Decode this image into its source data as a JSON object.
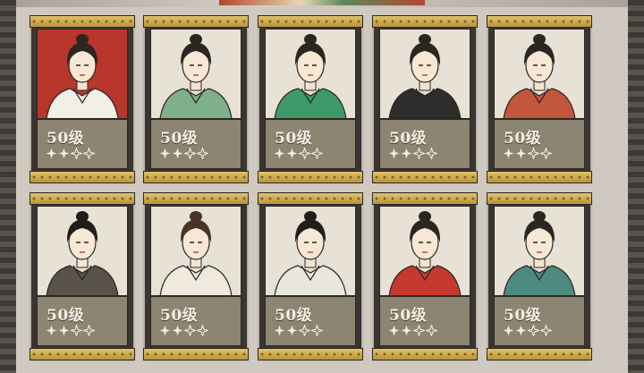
{
  "cards": [
    {
      "level": "50级",
      "stars": {
        "filled": 2,
        "total": 4
      },
      "portrait": {
        "bg": "#b8362c",
        "robe": "#f2efe6",
        "hair": "#2b2622",
        "name": "character-portrait-red-bg"
      }
    },
    {
      "level": "50级",
      "stars": {
        "filled": 2,
        "total": 4
      },
      "portrait": {
        "bg": "#e8e2d6",
        "robe": "#7eb08a",
        "hair": "#2b2622",
        "name": "character-portrait-plum-blossom"
      }
    },
    {
      "level": "50级",
      "stars": {
        "filled": 2,
        "total": 4
      },
      "portrait": {
        "bg": "#e8e2d6",
        "robe": "#3f9a6a",
        "hair": "#2b2622",
        "name": "character-portrait-brush-in-mouth"
      }
    },
    {
      "level": "50级",
      "stars": {
        "filled": 2,
        "total": 4
      },
      "portrait": {
        "bg": "#e8e2d6",
        "robe": "#2f2d2b",
        "hair": "#2b2622",
        "name": "character-portrait-black-headscarf"
      }
    },
    {
      "level": "50级",
      "stars": {
        "filled": 2,
        "total": 4
      },
      "portrait": {
        "bg": "#e8e2d6",
        "robe": "#c3573c",
        "hair": "#2b2622",
        "name": "character-portrait-spectacles"
      }
    },
    {
      "level": "50级",
      "stars": {
        "filled": 2,
        "total": 4
      },
      "portrait": {
        "bg": "#e8e2d6",
        "robe": "#5a534c",
        "hair": "#1f1c1a",
        "name": "character-portrait-long-hair"
      }
    },
    {
      "level": "50级",
      "stars": {
        "filled": 2,
        "total": 4
      },
      "portrait": {
        "bg": "#e8e2d6",
        "robe": "#efe9de",
        "hair": "#4a3426",
        "name": "character-portrait-curly-hair"
      }
    },
    {
      "level": "50级",
      "stars": {
        "filled": 2,
        "total": 4
      },
      "portrait": {
        "bg": "#e8e2d6",
        "robe": "#e9e6dd",
        "hair": "#211e1c",
        "name": "character-portrait-ponytail"
      }
    },
    {
      "level": "50级",
      "stars": {
        "filled": 2,
        "total": 4
      },
      "portrait": {
        "bg": "#e8e2d6",
        "robe": "#c63a2d",
        "hair": "#2b2622",
        "name": "character-portrait-red-robe"
      }
    },
    {
      "level": "50级",
      "stars": {
        "filled": 2,
        "total": 4
      },
      "portrait": {
        "bg": "#e8e2d6",
        "robe": "#4f8a80",
        "hair": "#2b2622",
        "name": "character-portrait-teal-robe"
      }
    }
  ],
  "colors": {
    "star_filled": "#f3efe4",
    "star_empty_stroke": "#f3efe4",
    "band_gold": "#e3c268",
    "panel": "#8d8571"
  }
}
